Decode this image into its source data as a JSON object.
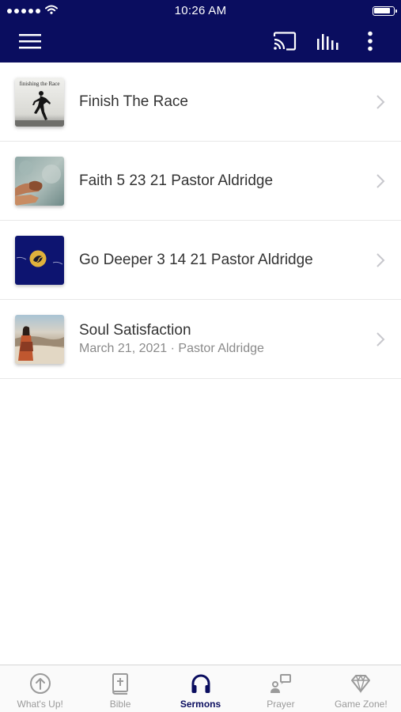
{
  "status_bar": {
    "time": "10:26 AM"
  },
  "sermons": [
    {
      "title": "Finish The Race",
      "subtitle": "",
      "thumb_text": "finishing the Race",
      "thumb_icon": "runner-thumbnail"
    },
    {
      "title": "Faith 5 23 21 Pastor Aldridge",
      "subtitle": "",
      "thumb_icon": "hands-thumbnail"
    },
    {
      "title": "Go Deeper 3 14 21 Pastor Aldridge",
      "subtitle": "",
      "thumb_icon": "deeper-logo-thumbnail"
    },
    {
      "title": "Soul Satisfaction",
      "subtitle": "March 21, 2021 · Pastor Aldridge",
      "thumb_icon": "desert-woman-thumbnail"
    }
  ],
  "tabs": [
    {
      "label": "What's Up!",
      "icon": "arrow-up-circle-icon",
      "active": false
    },
    {
      "label": "Bible",
      "icon": "bible-icon",
      "active": false
    },
    {
      "label": "Sermons",
      "icon": "headphones-icon",
      "active": true
    },
    {
      "label": "Prayer",
      "icon": "prayer-icon",
      "active": false
    },
    {
      "label": "Game Zone!",
      "icon": "diamond-icon",
      "active": false
    }
  ],
  "colors": {
    "header_bg": "#0a0d5f",
    "active_tab": "#0a0d5f",
    "inactive_tab": "#9a9a9a"
  }
}
